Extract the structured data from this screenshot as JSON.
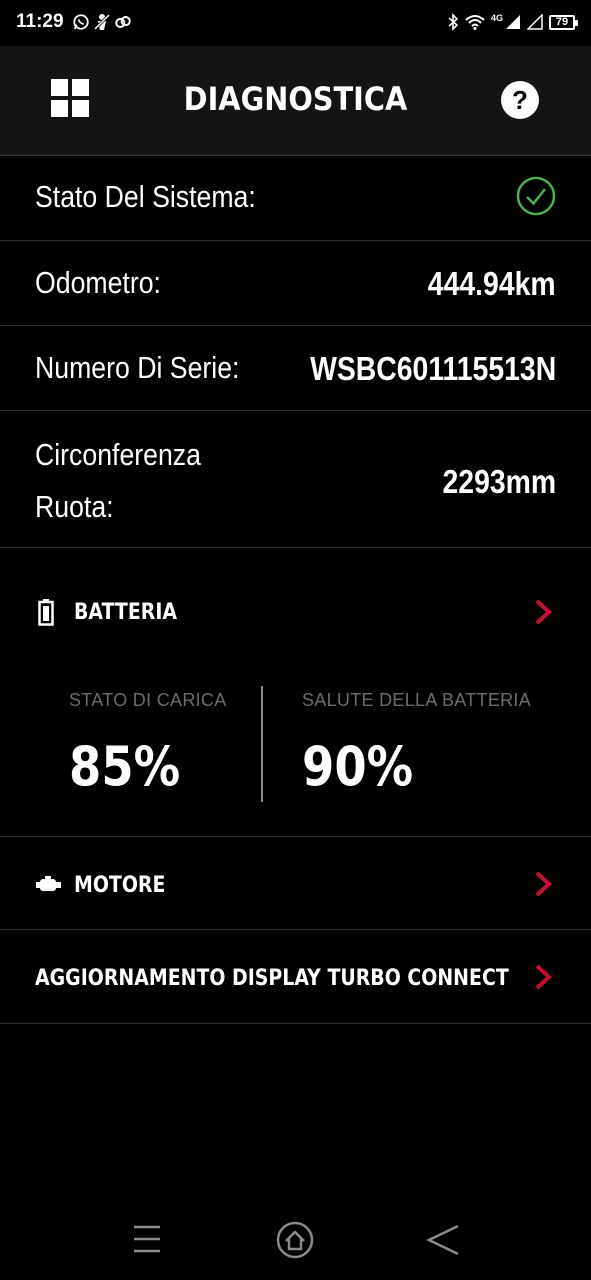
{
  "status_bar": {
    "time": "11:29",
    "network": "4G",
    "battery": "79"
  },
  "header": {
    "title": "DIAGNOSTICA",
    "help_label": "?"
  },
  "info": {
    "system_state_label": "Stato Del Sistema:",
    "odometer_label": "Odometro:",
    "odometer_value": "444.94km",
    "serial_label": "Numero Di Serie:",
    "serial_value": "WSBC601115513N",
    "wheel_label_line1": "Circonferenza",
    "wheel_label_line2": "Ruota:",
    "wheel_value": "2293mm"
  },
  "battery": {
    "title": "BATTERIA",
    "charge_label": "STATO DI CARICA",
    "charge_value": "85%",
    "health_label": "SALUTE DELLA BATTERIA",
    "health_value": "90%"
  },
  "motor": {
    "title": "MOTORE"
  },
  "display_update": {
    "title": "AGGIORNAMENTO DISPLAY TURBO CONNECT"
  },
  "colors": {
    "accent_red": "#c8102e",
    "check_green": "#4caf50",
    "header_bg": "#141414"
  }
}
